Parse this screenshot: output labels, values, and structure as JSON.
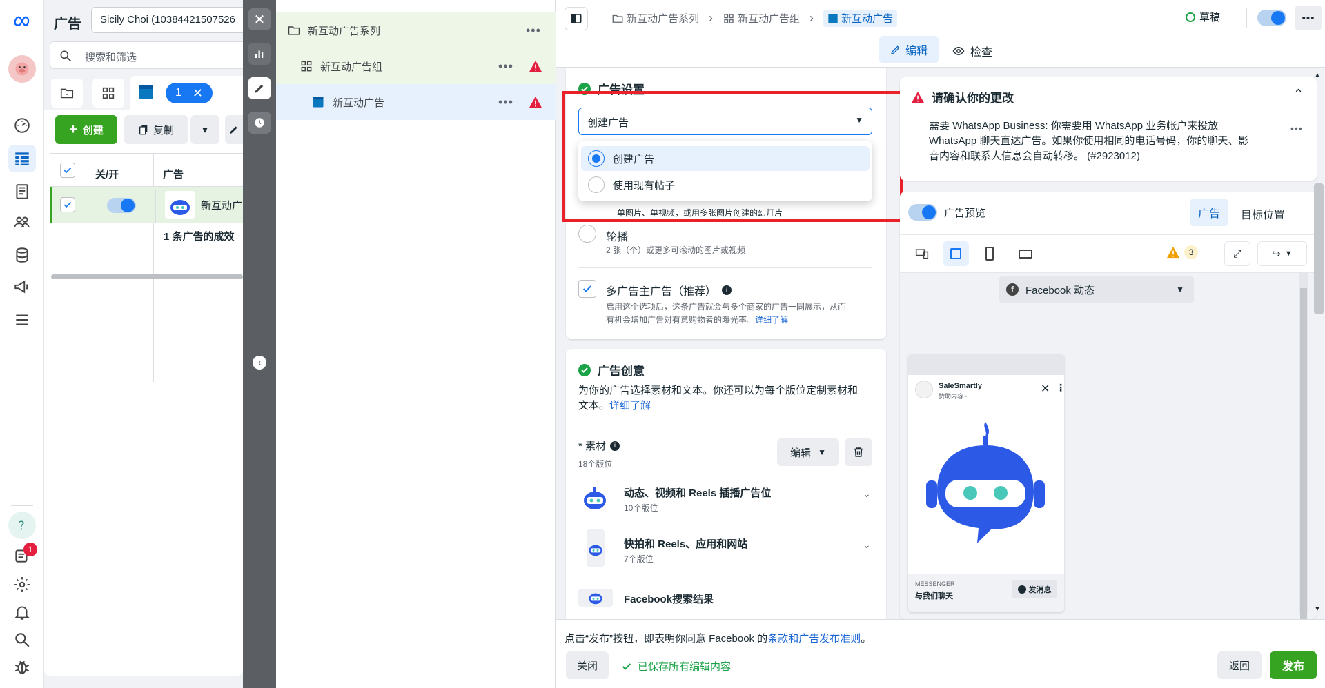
{
  "rail": {
    "icons": [
      "meta-logo",
      "avatar",
      "dashboard-icon",
      "table-icon",
      "pages-icon",
      "audience-icon",
      "billing-icon",
      "megaphone-icon",
      "menu-icon",
      "help-icon",
      "notifications-icon",
      "settings-icon",
      "bell-icon",
      "search-icon",
      "bug-icon"
    ],
    "notif_count": "1"
  },
  "manager": {
    "title": "广告",
    "account": "Sicily Choi (10384421507526",
    "search_placeholder": "搜索和筛选",
    "ad_tab_count": "1",
    "create_label": "创建",
    "copy_label": "复制",
    "col_toggle": "关/开",
    "col_ad": "广告",
    "row_name": "新互动广",
    "summary": "1 条广告的成效"
  },
  "tree": {
    "campaign": "新互动广告系列",
    "adset": "新互动广告组",
    "ad": "新互动广告"
  },
  "topbar": {
    "crumbs": [
      "新互动广告系列",
      "新互动广告组",
      "新互动广告"
    ],
    "status": "草稿",
    "edit_tab": "编辑",
    "review_tab": "检查"
  },
  "settings": {
    "title": "广告设置",
    "select_value": "创建广告",
    "options": [
      "创建广告",
      "使用现有帖子"
    ],
    "format_single_sub": "单图片、单视频，或用多张图片创建的幻灯片",
    "carousel": "轮播",
    "carousel_sub": "2 张（个）或更多可滚动的图片或视频",
    "multi": "多广告主广告（推荐）",
    "multi_desc1": "启用这个选项后，这条广告就会与多个商家的广告一同展示，从而",
    "multi_desc2": "有机会增加广告对有意购物者的曝光率。",
    "learn_more": "详细了解"
  },
  "creative": {
    "title": "广告创意",
    "desc1": "为你的广告选择素材和文本。你还可以为每个版位定制素材和",
    "desc2": "文本。",
    "learn_more": "详细了解",
    "media_label": "* 素材",
    "media_count": "18个版位",
    "edit_btn": "编辑",
    "placements": [
      {
        "title": "动态、视频和 Reels 插播广告位",
        "sub": "10个版位"
      },
      {
        "title": "快拍和 Reels、应用和网站",
        "sub": "7个版位"
      },
      {
        "title": "Facebook搜索结果",
        "sub": ""
      }
    ]
  },
  "warning": {
    "title": "请确认你的更改",
    "body1": "需要 WhatsApp Business: 你需要用 WhatsApp 业务帐户来投放",
    "body2": "WhatsApp 聊天直达广告。如果你使用相同的电话号码，你的聊天、影",
    "body3": "音内容和联系人信息会自动转移。 (#2923012)"
  },
  "preview": {
    "label": "广告预览",
    "tab_ad": "广告",
    "tab_target": "目标位置",
    "warn_count": "3",
    "placement": "Facebook 动态",
    "page_name": "SaleSmartly",
    "sponsored": "赞助内容 · ",
    "messenger": "MESSENGER",
    "cta_text": "与我们聊天",
    "send_btn": "发消息"
  },
  "footer": {
    "notice_pre": "点击“发布”按钮，即表明你同意 Facebook 的",
    "notice_link": "条款和广告发布准则",
    "notice_post": "。",
    "close": "关闭",
    "saved": "已保存所有编辑内容",
    "back": "返回",
    "publish": "发布"
  },
  "colors": {
    "accent": "#0a78be",
    "green": "#1ba348",
    "publish": "#36a420",
    "red": "#e41e3f",
    "warn": "#f0a000"
  }
}
